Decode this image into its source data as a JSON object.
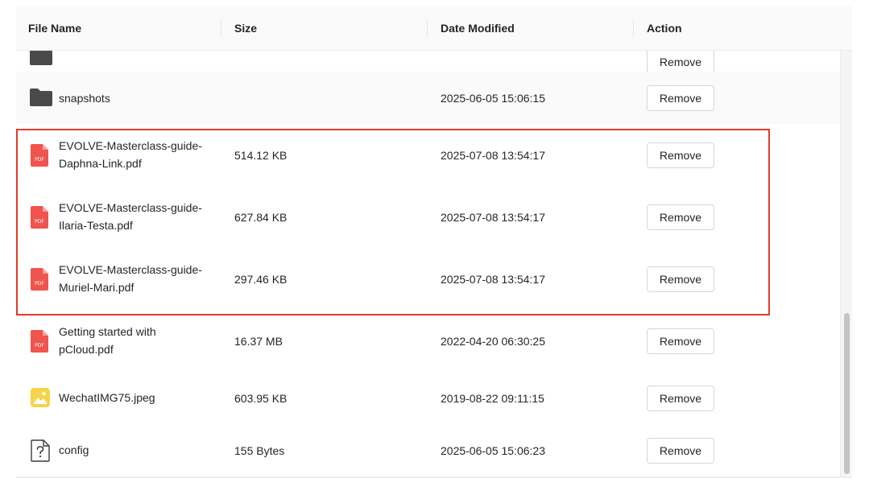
{
  "columns": {
    "file_name": "File Name",
    "size": "Size",
    "date_modified": "Date Modified",
    "action": "Action"
  },
  "files": [
    {
      "name": "",
      "size": "",
      "date": "",
      "icon": "folder-icon",
      "action": "Remove"
    },
    {
      "name": "snapshots",
      "size": "",
      "date": "2025-06-05 15:06:15",
      "icon": "folder-icon",
      "action": "Remove"
    },
    {
      "name": "EVOLVE-Masterclass-guide-Daphna-Link.pdf",
      "size": "514.12 KB",
      "date": "2025-07-08 13:54:17",
      "icon": "pdf-file-icon",
      "action": "Remove"
    },
    {
      "name": "EVOLVE-Masterclass-guide-Ilaria-Testa.pdf",
      "size": "627.84 KB",
      "date": "2025-07-08 13:54:17",
      "icon": "pdf-file-icon",
      "action": "Remove"
    },
    {
      "name": "EVOLVE-Masterclass-guide-Muriel-Mari.pdf",
      "size": "297.46 KB",
      "date": "2025-07-08 13:54:17",
      "icon": "pdf-file-icon",
      "action": "Remove"
    },
    {
      "name": "Getting started with pCloud.pdf",
      "size": "16.37 MB",
      "date": "2022-04-20 06:30:25",
      "icon": "pdf-file-icon",
      "action": "Remove"
    },
    {
      "name": "WechatIMG75.jpeg",
      "size": "603.95 KB",
      "date": "2019-08-22 09:11:15",
      "icon": "image-file-icon",
      "action": "Remove"
    },
    {
      "name": "config",
      "size": "155 Bytes",
      "date": "2025-06-05 15:06:23",
      "icon": "unknown-file-icon",
      "action": "Remove"
    }
  ],
  "icon_labels": {
    "pdf": "PDF"
  },
  "colors": {
    "highlight": "#e03b28",
    "pdf_icon": "#f0544f",
    "folder_icon": "#4a4a4a",
    "image_icon": "#f7d349"
  }
}
